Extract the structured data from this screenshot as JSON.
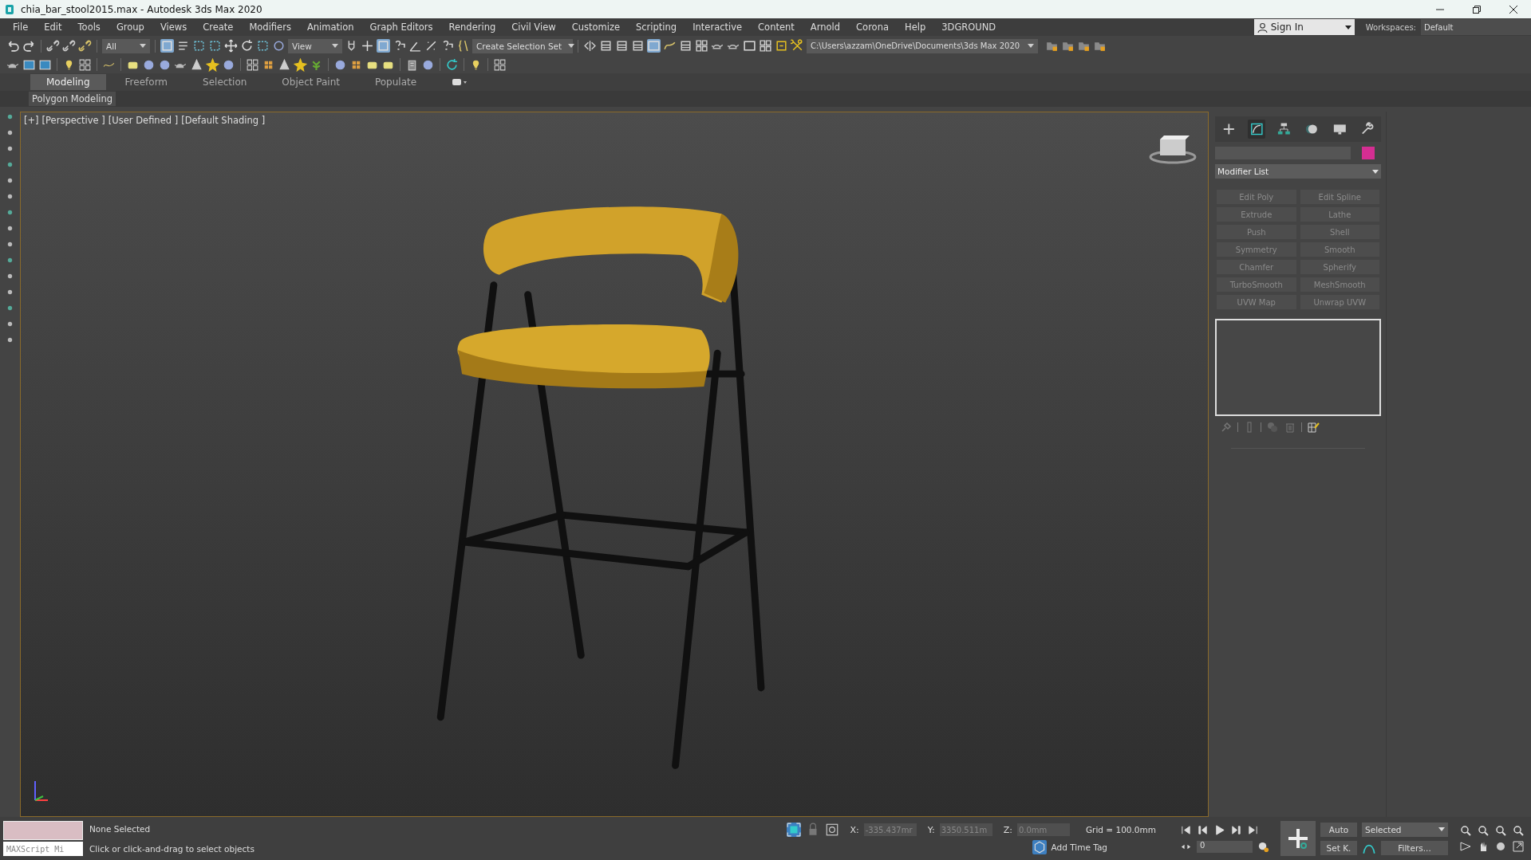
{
  "window": {
    "title": "chia_bar_stool2015.max - Autodesk 3ds Max 2020"
  },
  "menu": [
    "File",
    "Edit",
    "Tools",
    "Group",
    "Views",
    "Create",
    "Modifiers",
    "Animation",
    "Graph Editors",
    "Rendering",
    "Civil View",
    "Customize",
    "Scripting",
    "Interactive",
    "Content",
    "Arnold",
    "Corona",
    "Help",
    "3DGROUND"
  ],
  "account": {
    "sign_in": "Sign In",
    "workspaces_label": "Workspaces:",
    "workspace": "Default"
  },
  "toolbar": {
    "selection_filter": "All",
    "reference_coordinate": "View",
    "selection_set": "Create Selection Set",
    "project_path": "C:\\Users\\azzam\\OneDrive\\Documents\\3ds Max 2020"
  },
  "ribbon": {
    "tabs": [
      {
        "label": "Modeling",
        "selected": true
      },
      {
        "label": "Freeform",
        "selected": false
      },
      {
        "label": "Selection",
        "selected": false
      },
      {
        "label": "Object Paint",
        "selected": false
      },
      {
        "label": "Populate",
        "selected": false
      }
    ],
    "panel": "Polygon Modeling"
  },
  "viewport": {
    "labels": [
      "[+]",
      "[Perspective ]",
      "[User Defined ]",
      "[Default Shading ]"
    ]
  },
  "command_panel": {
    "tabs": [
      {
        "kind": "create",
        "selected": false
      },
      {
        "kind": "modify",
        "selected": true
      },
      {
        "kind": "hierarchy",
        "selected": false
      },
      {
        "kind": "motion",
        "selected": false
      },
      {
        "kind": "display",
        "selected": false
      },
      {
        "kind": "utilities",
        "selected": false
      }
    ],
    "modifier_list": "Modifier List",
    "modifiers": [
      {
        "label": "Edit Poly",
        "disabled": true
      },
      {
        "label": "Edit Spline",
        "disabled": true
      },
      {
        "label": "Extrude",
        "disabled": true
      },
      {
        "label": "Lathe",
        "disabled": true
      },
      {
        "label": "Push",
        "disabled": true
      },
      {
        "label": "Shell",
        "disabled": true
      },
      {
        "label": "Symmetry",
        "disabled": true
      },
      {
        "label": "Smooth",
        "disabled": true
      },
      {
        "label": "Chamfer",
        "disabled": true
      },
      {
        "label": "Spherify",
        "disabled": true
      },
      {
        "label": "TurboSmooth",
        "disabled": true
      },
      {
        "label": "MeshSmooth",
        "disabled": true
      },
      {
        "label": "UVW Map",
        "disabled": true
      },
      {
        "label": "Unwrap UVW",
        "disabled": true
      }
    ]
  },
  "status": {
    "maxscript": "MAXScript Mi",
    "selection": "None Selected",
    "prompt": "Click or click-and-drag to select objects",
    "x_label": "X:",
    "y_label": "Y:",
    "z_label": "Z:",
    "x": "-335.437mr",
    "y": "3350.511m",
    "z": "0.0mm",
    "grid": "Grid = 100.0mm",
    "time_tag": "Add Time Tag",
    "frame": "0",
    "auto_key": "Auto",
    "set_key": "Set K.",
    "key_filter": "Selected",
    "filters": "Filters..."
  }
}
